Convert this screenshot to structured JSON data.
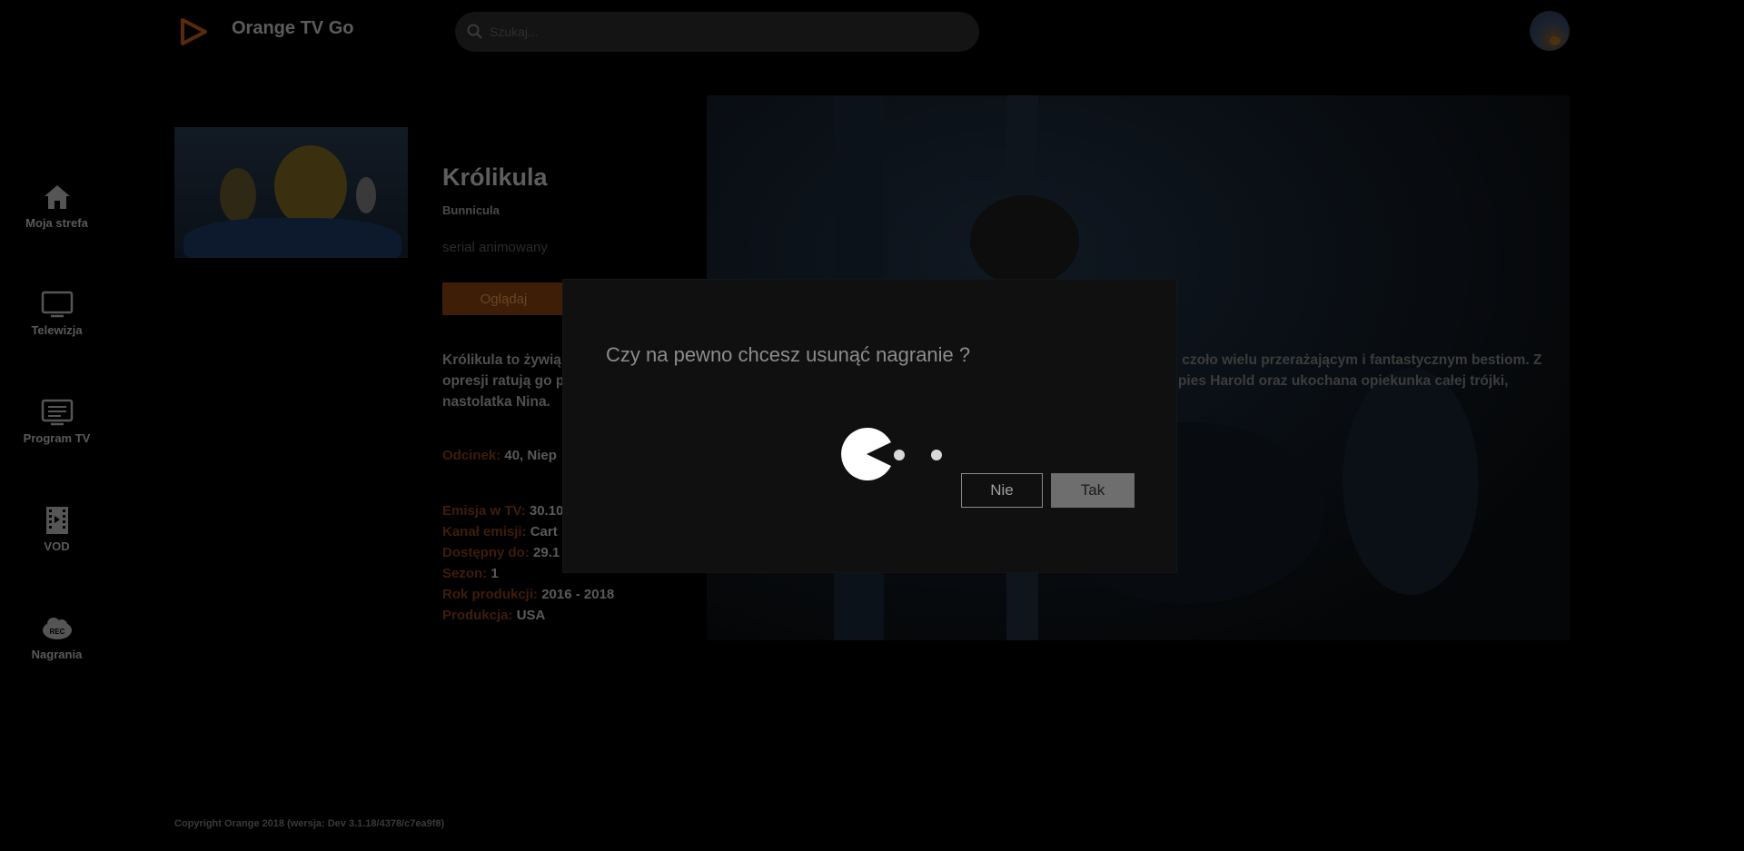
{
  "app": {
    "title": "Orange TV Go",
    "accent_color": "#ff7900",
    "logo_icon": "play-triangle-icon"
  },
  "search": {
    "placeholder": "Szukaj..."
  },
  "sidebar": {
    "items": [
      {
        "label": "Moja strefa",
        "icon": "home-icon"
      },
      {
        "label": "Telewizja",
        "icon": "tv-icon"
      },
      {
        "label": "Program TV",
        "icon": "tv-guide-icon"
      },
      {
        "label": "VOD",
        "icon": "film-strip-icon"
      },
      {
        "label": "Nagrania",
        "icon": "rec-cloud-icon"
      }
    ]
  },
  "show": {
    "title": "Królikula",
    "original_title": "Bunnicula",
    "genre": "serial animowany",
    "watch_label": "Oglądaj",
    "description_left": "Królikula to żywią",
    "description_left_2": "opresji ratują go p",
    "description_left_3": "nastolatka Nina.",
    "description_right_1": "ić czoło wielu przerażającym i fantastycznym bestiom. Z",
    "description_right_2": "y pies Harold oraz ukochana opiekunka całej trójki,",
    "episode_key": "Odcinek:",
    "episode_val": "40, Niep",
    "broadcast_key": "Emisja w TV:",
    "broadcast_val": "30.10",
    "channel_key": "Kanał emisji:",
    "channel_val": "Cart",
    "available_key": "Dostępny do:",
    "available_val": "29.1",
    "season_key": "Sezon:",
    "season_val": "1",
    "year_key": "Rok produkcji:",
    "year_val": "2016 - 2018",
    "production_key": "Produkcja:",
    "production_val": "USA"
  },
  "footer": {
    "copyright": "Copyright Orange 2018 (wersja: Dev 3.1.18/4378/c7ea9f8)"
  },
  "dialog": {
    "question": "Czy na pewno chcesz usunąć nagranie ?",
    "no_label": "Nie",
    "yes_label": "Tak",
    "loader_icon": "pacman-loader-icon"
  }
}
